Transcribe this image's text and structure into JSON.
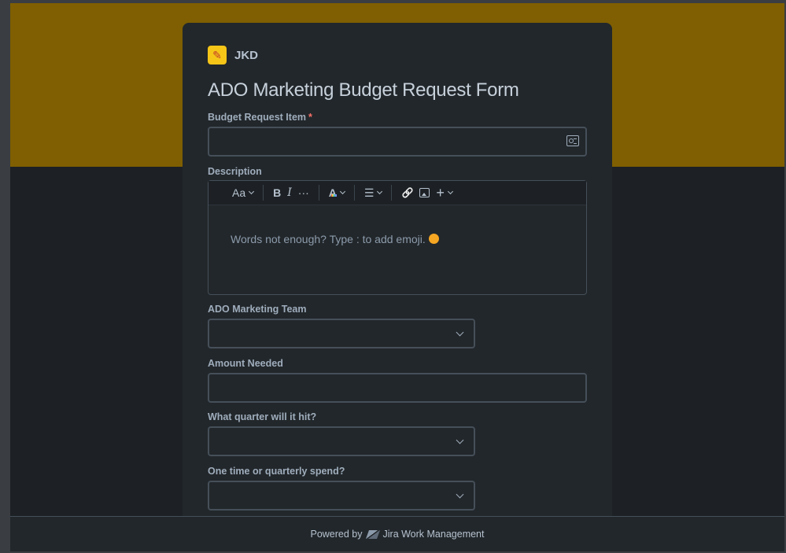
{
  "brand": {
    "name": "JKD",
    "icon": "pencil-icon",
    "icon_color": "#f5c518"
  },
  "form": {
    "title": "ADO Marketing Budget Request Form",
    "fields": {
      "budget_item": {
        "label": "Budget Request Item",
        "required_mark": "*",
        "value": ""
      },
      "description": {
        "label": "Description",
        "placeholder": "Words not enough? Type : to add emoji.",
        "toolbar": {
          "text_style": "Aa",
          "bold": "B",
          "italic": "I",
          "more": "···",
          "text_color": "A",
          "list": "☰",
          "link": "🔗",
          "insert": "+"
        }
      },
      "team": {
        "label": "ADO Marketing Team",
        "value": ""
      },
      "amount": {
        "label": "Amount Needed",
        "value": ""
      },
      "quarter": {
        "label": "What quarter will it hit?",
        "value": ""
      },
      "spend": {
        "label": "One time or quarterly spend?",
        "value": ""
      }
    }
  },
  "footer": {
    "powered_by": "Powered by",
    "product": "Jira Work Management"
  },
  "colors": {
    "banner": "#7f5f01",
    "background": "#1d2125",
    "card": "#22272b",
    "required": "#f87168"
  }
}
